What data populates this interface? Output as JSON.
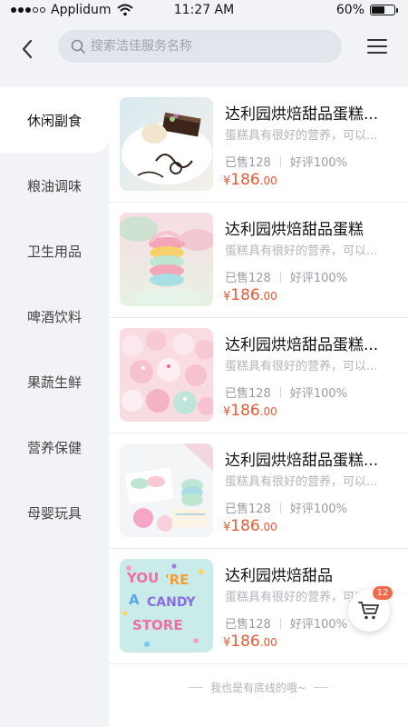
{
  "status_bar": {
    "carrier": "Applidum",
    "time": "11:27 AM",
    "battery_percent": "60%",
    "battery_level": 0.6
  },
  "header": {
    "search_placeholder": "搜索洁佳服务名称",
    "back_icon": "chevron-left-icon",
    "menu_icon": "hamburger-menu-icon"
  },
  "sidebar": {
    "items": [
      {
        "label": "休闲副食",
        "active": true
      },
      {
        "label": "粮油调味",
        "active": false
      },
      {
        "label": "卫生用品",
        "active": false
      },
      {
        "label": "啤酒饮料",
        "active": false
      },
      {
        "label": "果蔬生鲜",
        "active": false
      },
      {
        "label": "营养保健",
        "active": false
      },
      {
        "label": "母婴玩具",
        "active": false
      }
    ]
  },
  "products": [
    {
      "title": "达利园烘焙甜品蛋糕...",
      "desc": "蛋糕具有很好的营养，可以...",
      "sold": "已售128",
      "rating": "好评100%",
      "currency": "¥",
      "price_int": "186",
      "price_dec": ".00",
      "image": "cake-slice-dessert-image"
    },
    {
      "title": "达利园烘焙甜品蛋糕",
      "desc": "蛋糕具有很好的营养，可以...",
      "sold": "已售128",
      "rating": "好评100%",
      "currency": "¥",
      "price_int": "186",
      "price_dec": ".00",
      "image": "macaron-tower-image"
    },
    {
      "title": "达利园烘焙甜品蛋糕...",
      "desc": "蛋糕具有很好的营养，可以...",
      "sold": "已售128",
      "rating": "好评100%",
      "currency": "¥",
      "price_int": "186",
      "price_dec": ".00",
      "image": "pink-cake-pops-image"
    },
    {
      "title": "达利园烘焙甜品蛋糕...",
      "desc": "蛋糕具有很好的营养，可以...",
      "sold": "已售128",
      "rating": "好评100%",
      "currency": "¥",
      "price_int": "186",
      "price_dec": ".00",
      "image": "pastel-macarons-image"
    },
    {
      "title": "达利园烘焙甜品",
      "desc": "蛋糕具有很好的营养，可以...",
      "sold": "已售128",
      "rating": "好评100%",
      "currency": "¥",
      "price_int": "186",
      "price_dec": ".00",
      "image": "candy-store-letters-image"
    }
  ],
  "footer_note": "我也是有底线的哦~",
  "cart": {
    "badge_count": "12",
    "icon": "shopping-cart-icon"
  },
  "colors": {
    "accent": "#e85a36",
    "badge": "#f16b4b",
    "sidebar_bg": "#f2f3f7"
  }
}
